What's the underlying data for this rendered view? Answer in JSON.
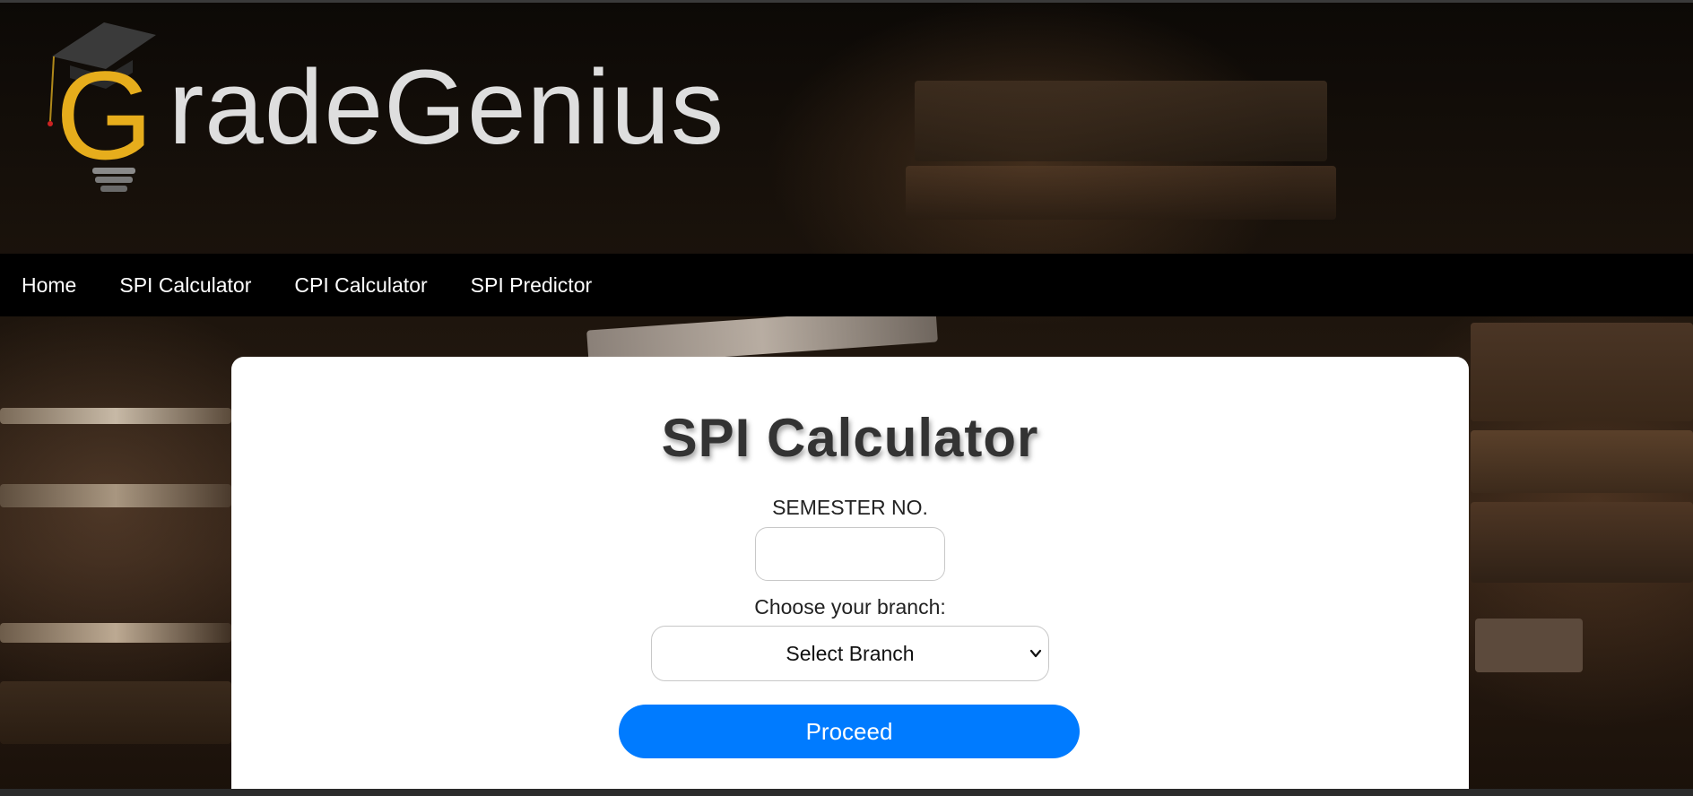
{
  "brand": {
    "name": "GradeGenius",
    "initial": "G",
    "rest": "radeGenius",
    "accent_color": "#e6ad1c",
    "text_color": "#dedede"
  },
  "nav": {
    "items": [
      {
        "label": "Home"
      },
      {
        "label": "SPI Calculator"
      },
      {
        "label": "CPI Calculator"
      },
      {
        "label": "SPI Predictor"
      }
    ]
  },
  "card": {
    "title": "SPI Calculator",
    "semester_label": "SEMESTER NO.",
    "semester_value": "",
    "branch_label": "Choose your branch:",
    "branch_selected": "Select Branch",
    "proceed_label": "Proceed",
    "button_color": "#007bff"
  }
}
